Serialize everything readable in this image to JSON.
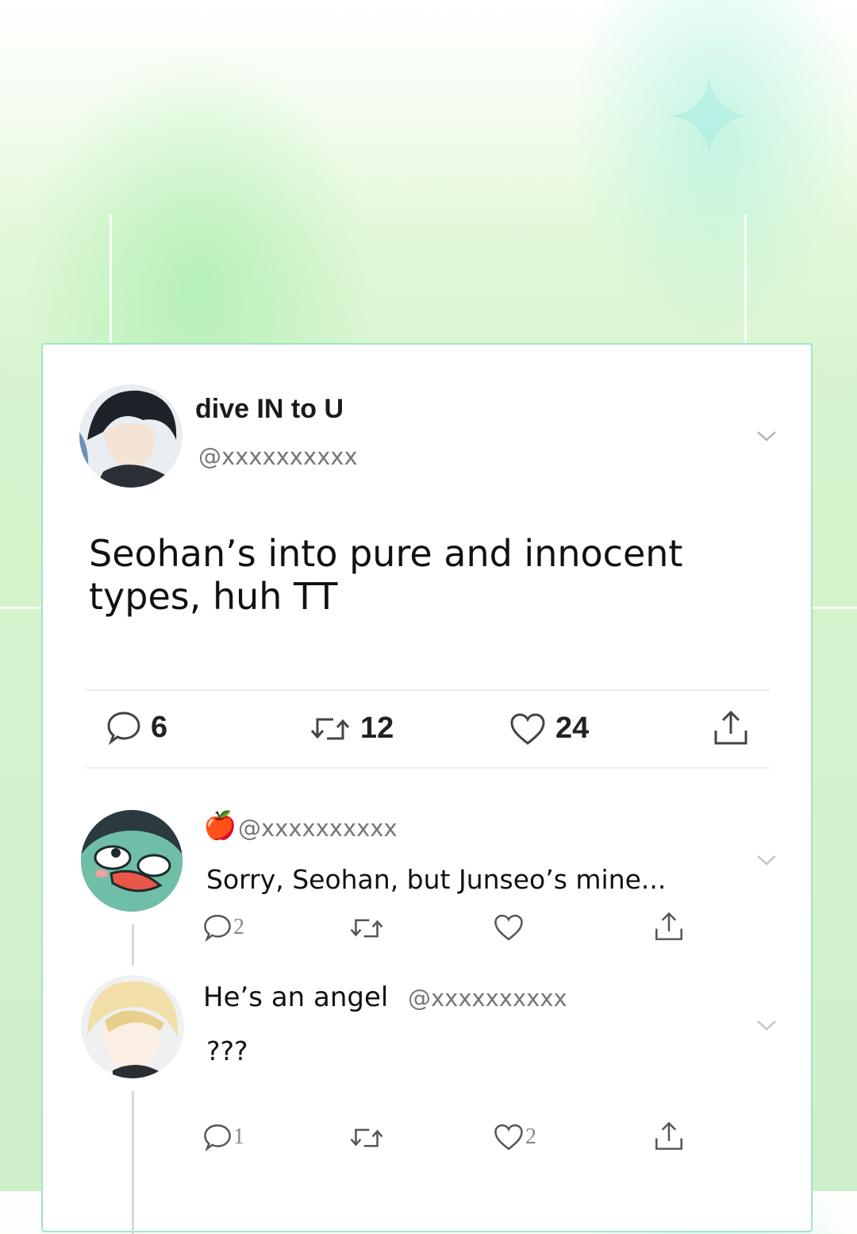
{
  "tweet": {
    "display_name": "dive IN to U",
    "handle": "@xxxxxxxxxx",
    "text": "Seohan’s into pure and innocent types, huh TT",
    "replies_count": "6",
    "retweets_count": "12",
    "likes_count": "24"
  },
  "replies": [
    {
      "emoji": "🍎",
      "handle": "@xxxxxxxxxx",
      "text": "Sorry, Seohan, but Junseo’s mine...",
      "replies_count": "2",
      "likes_count": ""
    },
    {
      "display_name": "He’s an angel",
      "handle": "@xxxxxxxxxx",
      "text": "???",
      "replies_count": "1",
      "likes_count": "2"
    }
  ],
  "icons": [
    "reply-icon",
    "retweet-icon",
    "like-icon",
    "share-icon",
    "chevron-down-icon"
  ],
  "colors": {
    "card_border": "#9ee6c6",
    "background": "#d6f4cd"
  }
}
